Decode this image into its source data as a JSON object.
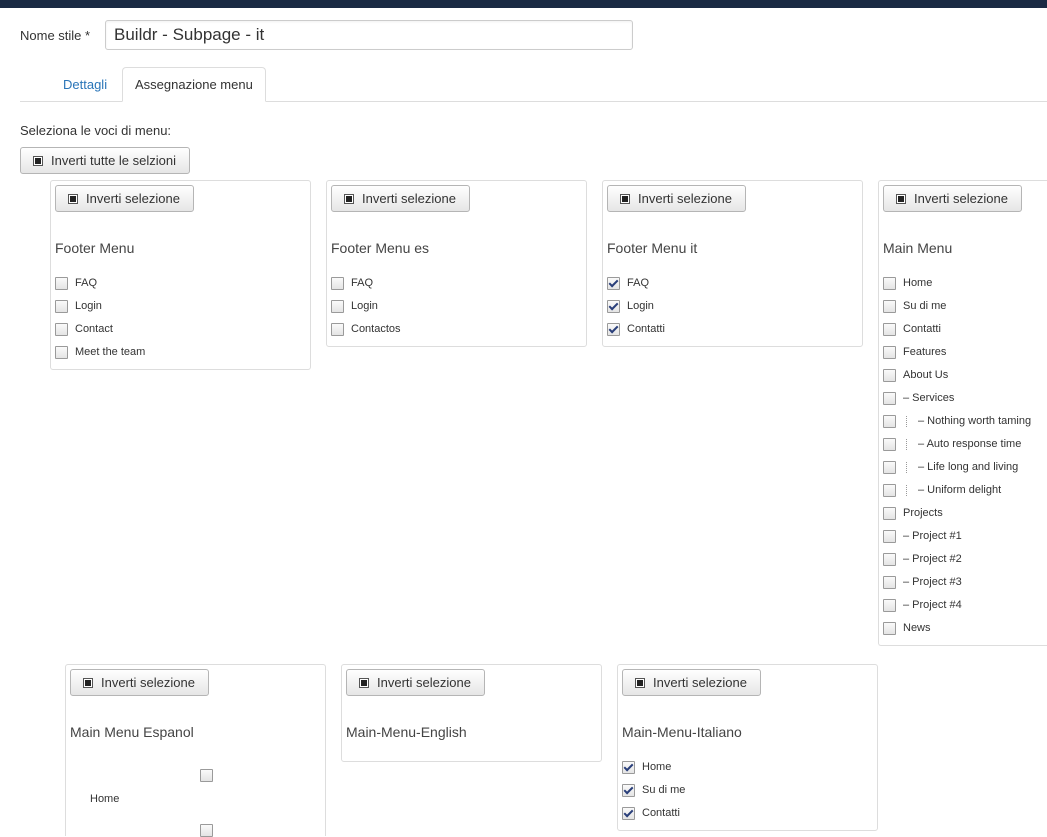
{
  "form": {
    "style_name_label": "Nome stile *",
    "style_name_value": "Buildr - Subpage - it"
  },
  "tabs": [
    {
      "label": "Dettagli",
      "active": false
    },
    {
      "label": "Assegnazione menu",
      "active": true
    }
  ],
  "assignment": {
    "select_label": "Seleziona le voci di menu:",
    "invert_all_label": "Inverti tutte le selzioni",
    "invert_selection_label": "Inverti selezione"
  },
  "menus": [
    {
      "title": "Footer Menu",
      "items": [
        {
          "label": "FAQ",
          "checked": false
        },
        {
          "label": "Login",
          "checked": false
        },
        {
          "label": "Contact",
          "checked": false
        },
        {
          "label": "Meet the team",
          "checked": false
        }
      ]
    },
    {
      "title": "Footer Menu es",
      "items": [
        {
          "label": "FAQ",
          "checked": false
        },
        {
          "label": "Login",
          "checked": false
        },
        {
          "label": "Contactos",
          "checked": false
        }
      ]
    },
    {
      "title": "Footer Menu it",
      "items": [
        {
          "label": "FAQ",
          "checked": true
        },
        {
          "label": "Login",
          "checked": true
        },
        {
          "label": "Contatti",
          "checked": true
        }
      ]
    },
    {
      "title": "Main Menu",
      "items": [
        {
          "label": "Home",
          "checked": false,
          "depth": 0
        },
        {
          "label": "Su di me",
          "checked": false,
          "depth": 0
        },
        {
          "label": "Contatti",
          "checked": false,
          "depth": 0
        },
        {
          "label": "Features",
          "checked": false,
          "depth": 0
        },
        {
          "label": "About Us",
          "checked": false,
          "depth": 0
        },
        {
          "label": "– Services",
          "checked": false,
          "depth": 0
        },
        {
          "label": "– Nothing worth taming",
          "checked": false,
          "depth": 1
        },
        {
          "label": "– Auto response time",
          "checked": false,
          "depth": 1
        },
        {
          "label": "– Life long and living",
          "checked": false,
          "depth": 1
        },
        {
          "label": "– Uniform delight",
          "checked": false,
          "depth": 1
        },
        {
          "label": "Projects",
          "checked": false,
          "depth": 0
        },
        {
          "label": "– Project #1",
          "checked": false,
          "depth": 0
        },
        {
          "label": "– Project #2",
          "checked": false,
          "depth": 0
        },
        {
          "label": "– Project #3",
          "checked": false,
          "depth": 0
        },
        {
          "label": "– Project #4",
          "checked": false,
          "depth": 0
        },
        {
          "label": "News",
          "checked": false,
          "depth": 0
        }
      ]
    },
    {
      "title": "Main Menu Espanol",
      "items": [
        {
          "label": "Home",
          "checked": false
        }
      ]
    },
    {
      "title": "Main-Menu-English",
      "items": []
    },
    {
      "title": "Main-Menu-Italiano",
      "items": [
        {
          "label": "Home",
          "checked": true
        },
        {
          "label": "Su di me",
          "checked": true
        },
        {
          "label": "Contatti",
          "checked": true
        }
      ]
    }
  ]
}
